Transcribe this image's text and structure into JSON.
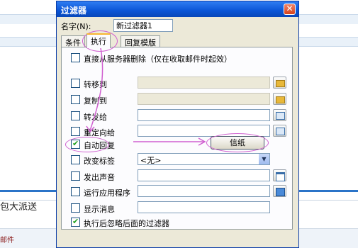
{
  "background": {
    "text_1": "包大派送",
    "text_2": "邮件"
  },
  "dialog": {
    "title": "过滤器",
    "close_glyph": "✕",
    "name_label": "名字(N):",
    "name_value": "新过滤器1"
  },
  "tabs": [
    {
      "label": "条件"
    },
    {
      "label": "执行"
    },
    {
      "label": "回复模版"
    }
  ],
  "actions": [
    {
      "label": "直接从服务器删除（仅在收取邮件时起效）",
      "checked": false
    },
    {
      "label": "转移到",
      "checked": false,
      "icon": "folder-icon"
    },
    {
      "label": "复制到",
      "checked": false,
      "icon": "folder-icon"
    },
    {
      "label": "转发给",
      "checked": false,
      "icon": "address-book-icon"
    },
    {
      "label": "重定向给",
      "checked": false,
      "icon": "address-book-icon"
    },
    {
      "label": "自动回复",
      "checked": true,
      "button": "信纸"
    },
    {
      "label": "改变标签",
      "checked": false,
      "select_value": "<无>"
    },
    {
      "label": "发出声音",
      "checked": false,
      "icon": "list-icon"
    },
    {
      "label": "运行应用程序",
      "checked": false,
      "icon": "browse-icon"
    },
    {
      "label": "显示消息",
      "checked": false
    },
    {
      "label": "执行后忽略后面的过滤器",
      "checked": true
    }
  ],
  "colors": {
    "titlebar": "#0a55d6",
    "annotation": "#d060d0"
  }
}
